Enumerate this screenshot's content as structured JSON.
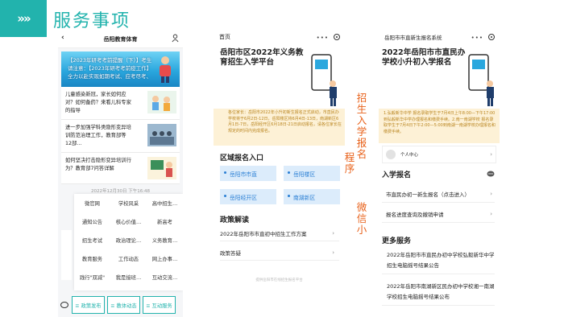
{
  "header": {
    "arrows": "»»",
    "title": "服务事项"
  },
  "phone1": {
    "nav_title": "岳阳教育体育",
    "back": "‹",
    "banner_text": "【2023年研考考前提醒（下）】考生请注意：【2023年研考考前疫工作】 全力以赴实现如期考试、应考尽考、平安研考！",
    "news": [
      "儿童感染新冠，家长如何应对？如何备药？来看儿科专家的指导",
      "进一步加强学科类隐形变异培训防范治理工作，教育部等12部…",
      "如何坚决打击隐形变异培训行为？教育部7问答详解"
    ],
    "date": "2022年12月30日 下午16:48",
    "menu": [
      [
        "微官网",
        "学校风采",
        "高中招生…"
      ],
      [
        "通知公告",
        "核心价值…",
        "新高考"
      ],
      [
        "招生考试",
        "政治理论…",
        "义务教育…"
      ],
      [
        "教育服务",
        "工作动态",
        "网上办事…"
      ],
      [
        "践行\"双减\"",
        "我是接班…",
        "互动交流…"
      ]
    ],
    "tabs": [
      "≡ 政策发布",
      "≡ 教体动态",
      "≡ 互动服务"
    ]
  },
  "phone2": {
    "nav_title": "首页",
    "dots": "•••",
    "title": "岳阳市区2022年义务教育招生入学平台",
    "notice": "各位家长：岳阳市2022年小升初新生报名正式启动，市直民办学校将于6月2日-12日，岳阳楼区将6月4日-13日，南湖新区6月1日-7日，岳阳经开区6月18日-21日启动报名，请各位家长在规定的时间内完成报名。",
    "region_title": "区域报名入口",
    "regions": [
      "岳阳市市直",
      "岳阳楼区",
      "岳阳经开区",
      "南湖新区"
    ],
    "policy_title": "政策解读",
    "policies": [
      "2022年岳阳市市直初中招生工作方案",
      "政策答疑"
    ],
    "footer": "提供岳阳市在线招生报名平台"
  },
  "phone3": {
    "nav_title": "岳阳市市直新生报名系统",
    "dots": "•••",
    "title": "2022年岳阳市市直民办学校小升初入学报名",
    "notice": "1.弘毅新华中学 报名录取学生于7月4日上午8:00—下午17:00到弘毅新华中学办理报名和缴费手续。2.南一南湖学校 报名录取学生于7月4日下午2:00—5:00到南湖一南湖学校办理报名和缴费手续。",
    "user_label": "个人中心",
    "apply_title": "入学报名",
    "apply_items": [
      "市直民办初一新生报名（点击进入）",
      "报名进度查询及撤销申请"
    ],
    "more_title": "更多服务",
    "more_items": [
      "2022年岳阳市市直民办初中学校弘毅新华中学招生电脑摇号结果公告",
      "2022年岳阳市南湖新区民办初中学校湘一南湖学校招生电脑摇号结果公布"
    ]
  },
  "annotations": {
    "a1": "招生入学报名",
    "a2": "程序",
    "a3": "微信小"
  },
  "colors": {
    "teal": "#22b3ad",
    "orange": "#e8611a",
    "blue": "#2a7fd4",
    "notice_bg": "#fdf1d6"
  }
}
